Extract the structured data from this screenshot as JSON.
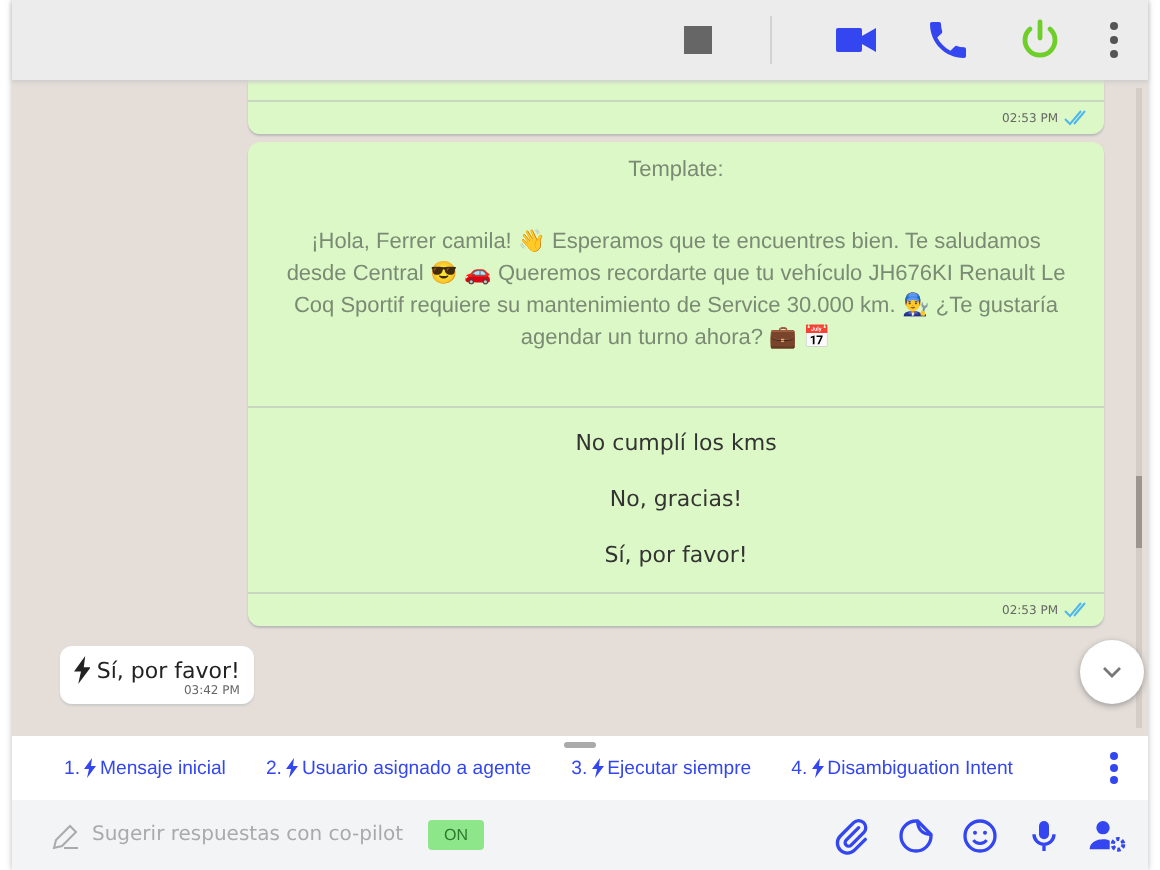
{
  "header": {
    "buttons": [
      {
        "kind": "stop"
      },
      {
        "kind": "video"
      },
      {
        "kind": "phone"
      },
      {
        "kind": "power"
      },
      {
        "kind": "more"
      }
    ]
  },
  "messages": [
    {
      "kind": "outgoing-cut",
      "time": "02:53 PM",
      "read": true
    },
    {
      "kind": "template",
      "title": "Template:",
      "body": "¡Hola, Ferrer camila! 👋 Esperamos que te encuentres bien. Te saludamos desde Central 😎 🚗 Queremos recordarte que tu vehículo JH676KI Renault Le Coq Sportif requiere su mantenimiento de Service 30.000 km. 👨‍🔧 ¿Te gustaría agendar un turno ahora? 💼 📅",
      "options": [
        "No cumplí los kms",
        "No, gracias!",
        "Sí, por favor!"
      ],
      "time": "02:53 PM",
      "read": true
    },
    {
      "kind": "incoming",
      "text": "Sí, por favor!",
      "time": "03:42 PM"
    }
  ],
  "quick_replies": [
    {
      "number": "1.",
      "label": "Mensaje inicial"
    },
    {
      "number": "2.",
      "label": "Usuario asignado a agente"
    },
    {
      "number": "3.",
      "label": "Ejecutar siempre"
    },
    {
      "number": "4.",
      "label": "Disambiguation Intent"
    }
  ],
  "composer": {
    "placeholder": "Sugerir respuestas con co-pilot",
    "copilot": {
      "label": "ON",
      "on": true
    },
    "tools": [
      {
        "kind": "attach"
      },
      {
        "kind": "sticker"
      },
      {
        "kind": "emoji"
      },
      {
        "kind": "mic"
      },
      {
        "kind": "agent-settings"
      }
    ]
  }
}
